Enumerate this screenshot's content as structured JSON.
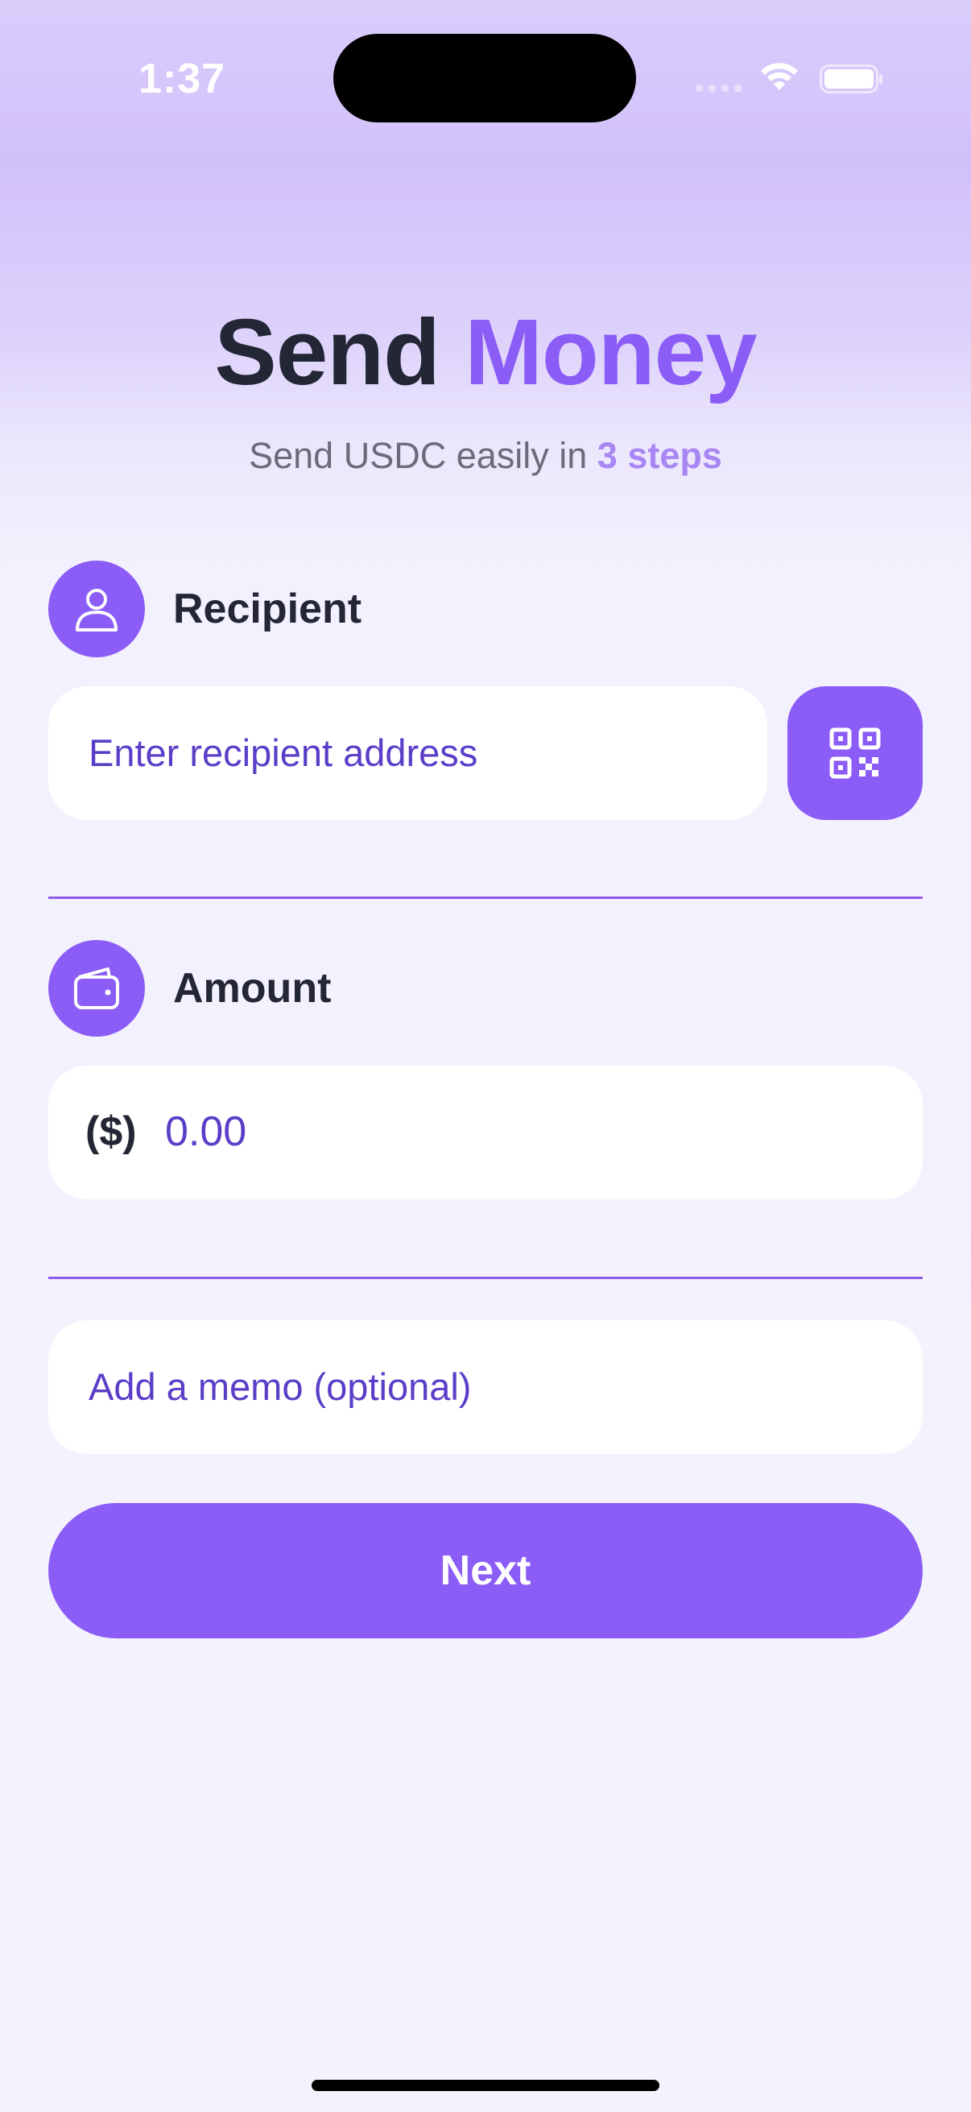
{
  "status_bar": {
    "time": "1:37"
  },
  "header": {
    "title_part1": "Send",
    "title_part2": "Money",
    "subtitle_prefix": "Send USDC easily in",
    "subtitle_highlight": "3 steps"
  },
  "recipient": {
    "label": "Recipient",
    "placeholder": "Enter recipient address",
    "icon": "person-icon",
    "scan_icon": "qr-code-icon"
  },
  "amount": {
    "label": "Amount",
    "currency": "($)",
    "value": "0.00",
    "icon": "wallet-icon"
  },
  "memo": {
    "placeholder": "Add a memo (optional)"
  },
  "actions": {
    "next_label": "Next"
  },
  "colors": {
    "accent": "#8b5cf6",
    "title_dark": "#232634",
    "placeholder": "#5b3ec8",
    "background": "#f4f2fd",
    "header_gradient": "#d2c1fb"
  }
}
